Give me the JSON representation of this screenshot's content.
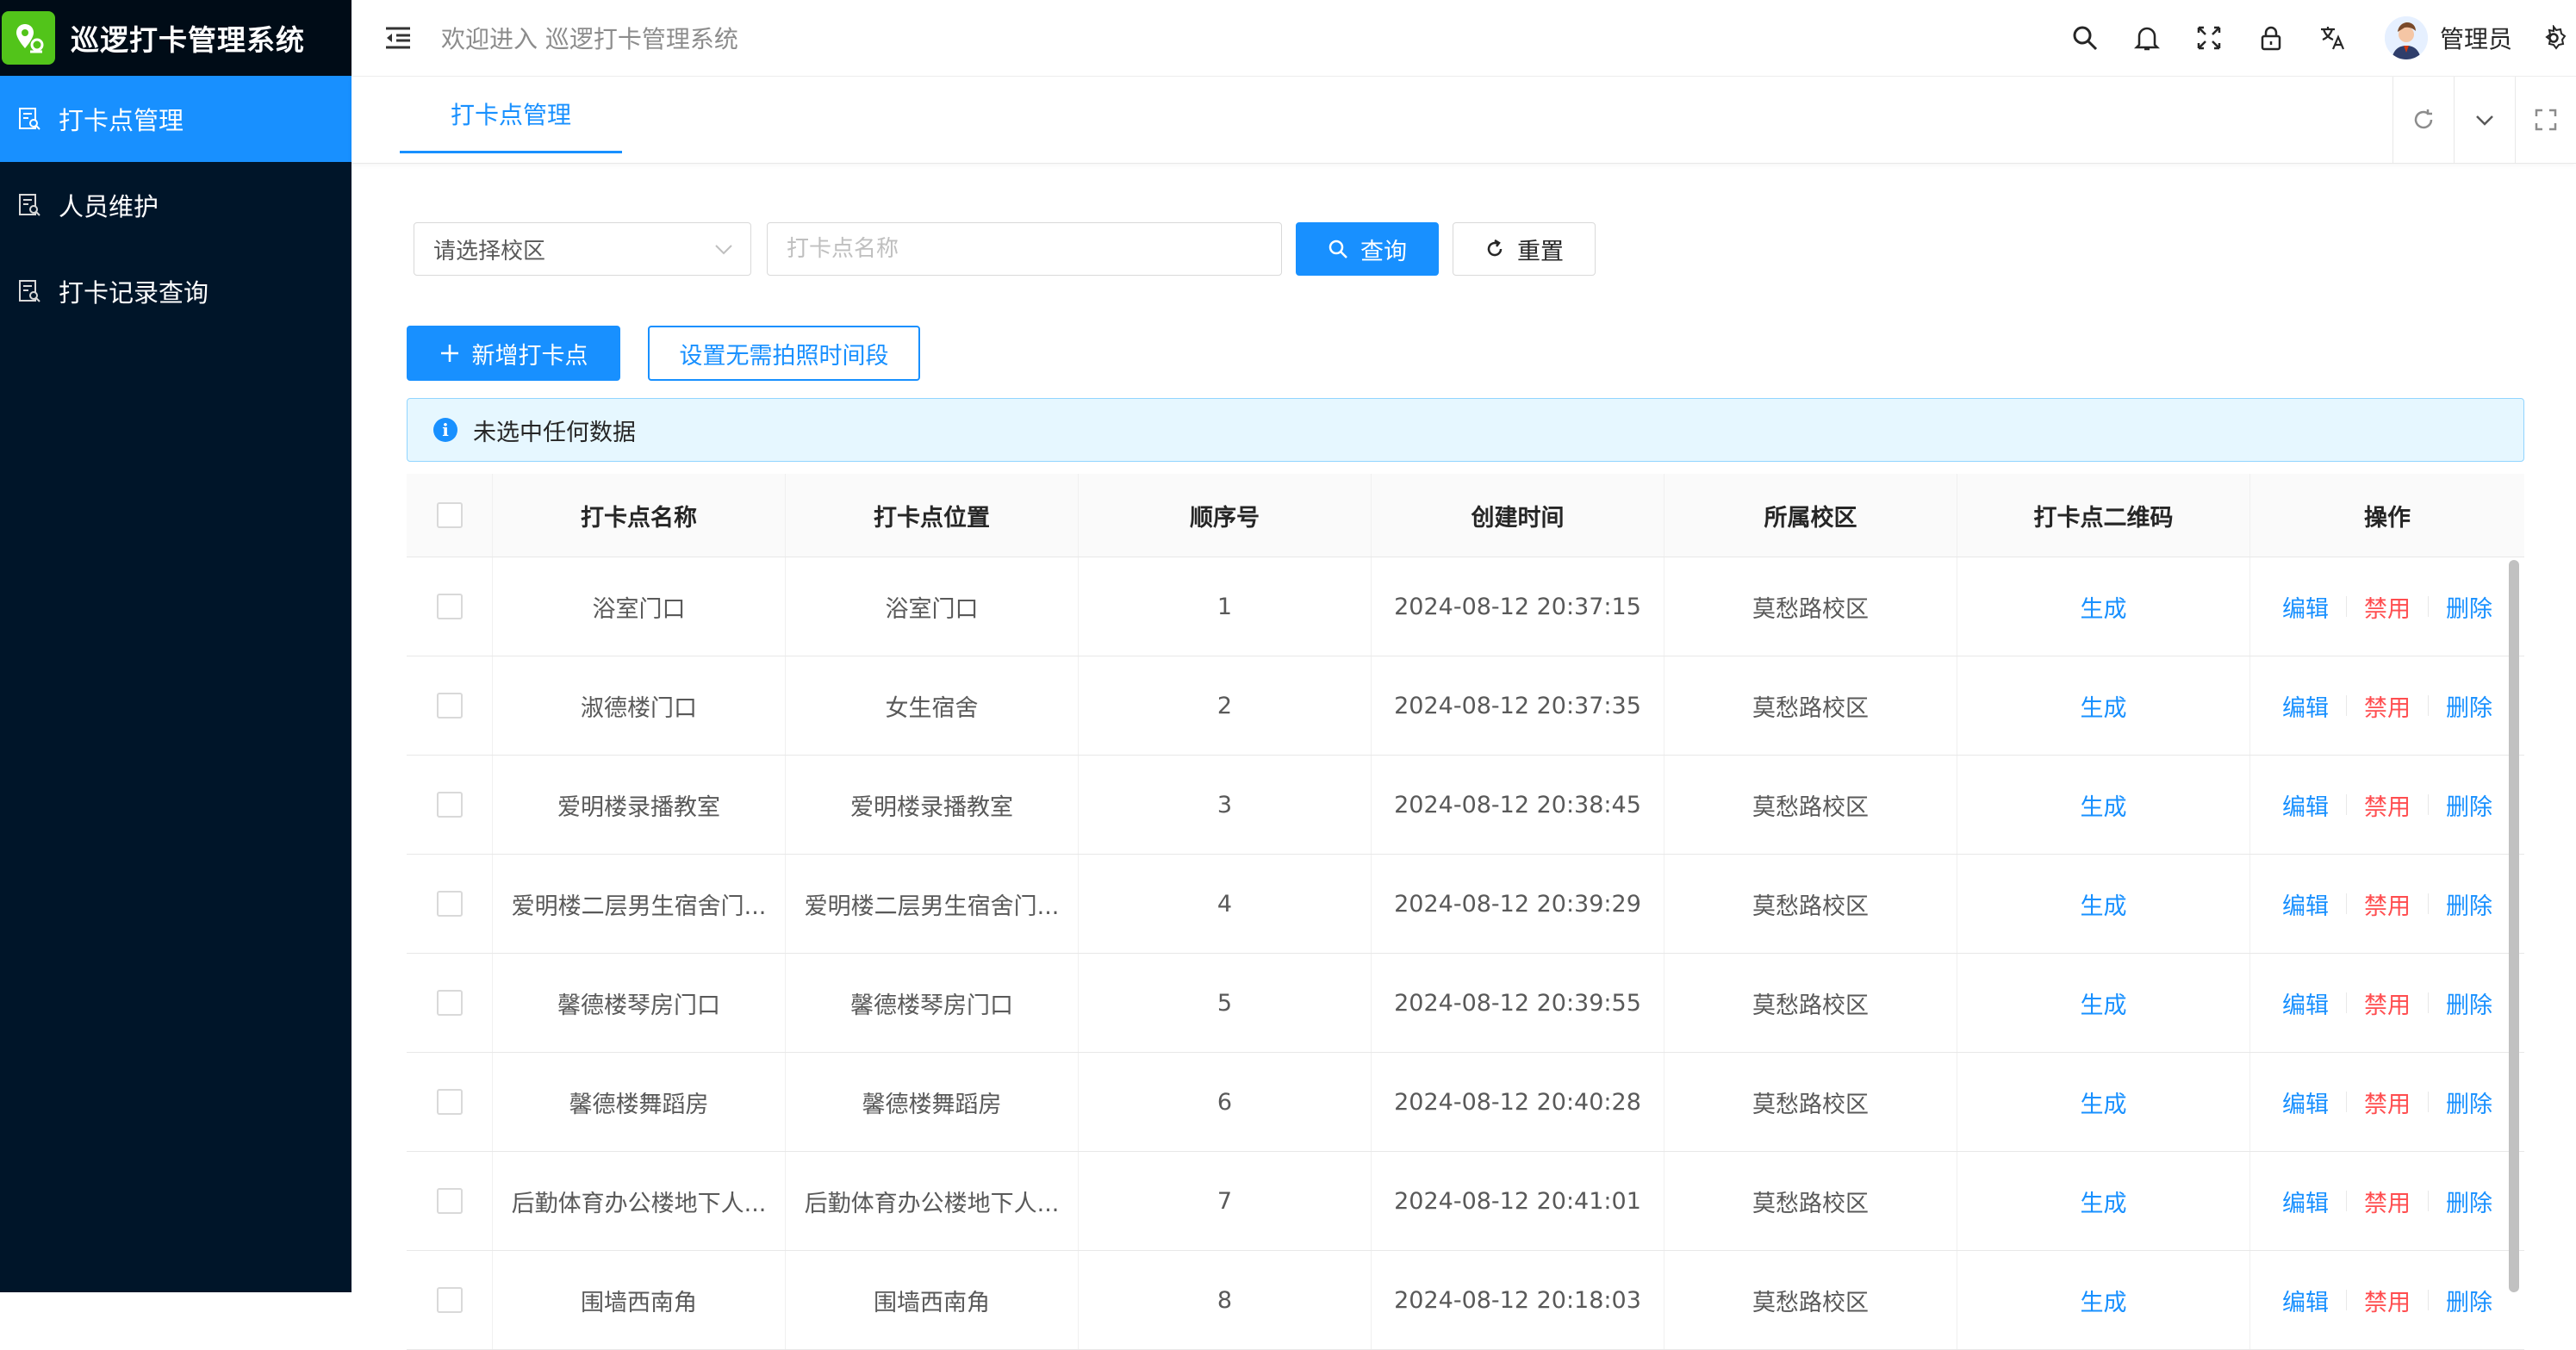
{
  "app": {
    "title": "巡逻打卡管理系统"
  },
  "sidebar": {
    "items": [
      {
        "label": "打卡点管理",
        "active": true,
        "icon": "list-search-icon"
      },
      {
        "label": "人员维护",
        "active": false,
        "icon": "list-search-icon"
      },
      {
        "label": "打卡记录查询",
        "active": false,
        "icon": "list-search-icon"
      }
    ]
  },
  "header": {
    "welcome": "欢迎进入 巡逻打卡管理系统",
    "user": "管理员",
    "icons": [
      "search-icon",
      "bell-icon",
      "fullscreen-icon",
      "lock-icon",
      "translate-icon",
      "settings-icon"
    ]
  },
  "tabs": [
    {
      "label": "打卡点管理"
    }
  ],
  "search": {
    "campus_placeholder": "请选择校区",
    "name_placeholder": "打卡点名称",
    "query_label": "查询",
    "reset_label": "重置"
  },
  "toolbar": {
    "add_label": "新增打卡点",
    "set_time_label": "设置无需拍照时间段"
  },
  "alert": {
    "text": "未选中任何数据"
  },
  "table": {
    "headers": [
      "打卡点名称",
      "打卡点位置",
      "顺序号",
      "创建时间",
      "所属校区",
      "打卡点二维码",
      "操作"
    ],
    "rows": [
      {
        "name": "浴室门口",
        "location": "浴室门口",
        "order": "1",
        "created": "2024-08-12 20:37:15",
        "campus": "莫愁路校区",
        "qr": "生成",
        "edit": "编辑",
        "disable": "禁用",
        "delete": "删除"
      },
      {
        "name": "淑德楼门口",
        "location": "女生宿舍",
        "order": "2",
        "created": "2024-08-12 20:37:35",
        "campus": "莫愁路校区",
        "qr": "生成",
        "edit": "编辑",
        "disable": "禁用",
        "delete": "删除"
      },
      {
        "name": "爱明楼录播教室",
        "location": "爱明楼录播教室",
        "order": "3",
        "created": "2024-08-12 20:38:45",
        "campus": "莫愁路校区",
        "qr": "生成",
        "edit": "编辑",
        "disable": "禁用",
        "delete": "删除"
      },
      {
        "name": "爱明楼二层男生宿舍门...",
        "location": "爱明楼二层男生宿舍门...",
        "order": "4",
        "created": "2024-08-12 20:39:29",
        "campus": "莫愁路校区",
        "qr": "生成",
        "edit": "编辑",
        "disable": "禁用",
        "delete": "删除"
      },
      {
        "name": "馨德楼琴房门口",
        "location": "馨德楼琴房门口",
        "order": "5",
        "created": "2024-08-12 20:39:55",
        "campus": "莫愁路校区",
        "qr": "生成",
        "edit": "编辑",
        "disable": "禁用",
        "delete": "删除"
      },
      {
        "name": "馨德楼舞蹈房",
        "location": "馨德楼舞蹈房",
        "order": "6",
        "created": "2024-08-12 20:40:28",
        "campus": "莫愁路校区",
        "qr": "生成",
        "edit": "编辑",
        "disable": "禁用",
        "delete": "删除"
      },
      {
        "name": "后勤体育办公楼地下人...",
        "location": "后勤体育办公楼地下人...",
        "order": "7",
        "created": "2024-08-12 20:41:01",
        "campus": "莫愁路校区",
        "qr": "生成",
        "edit": "编辑",
        "disable": "禁用",
        "delete": "删除"
      },
      {
        "name": "围墙西南角",
        "location": "围墙西南角",
        "order": "8",
        "created": "2024-08-12 20:18:03",
        "campus": "莫愁路校区",
        "qr": "生成",
        "edit": "编辑",
        "disable": "禁用",
        "delete": "删除"
      }
    ]
  },
  "colors": {
    "primary": "#1890ff",
    "sidebar": "#001529",
    "logo_badge": "#52c41a",
    "danger": "#ff4d4f"
  }
}
